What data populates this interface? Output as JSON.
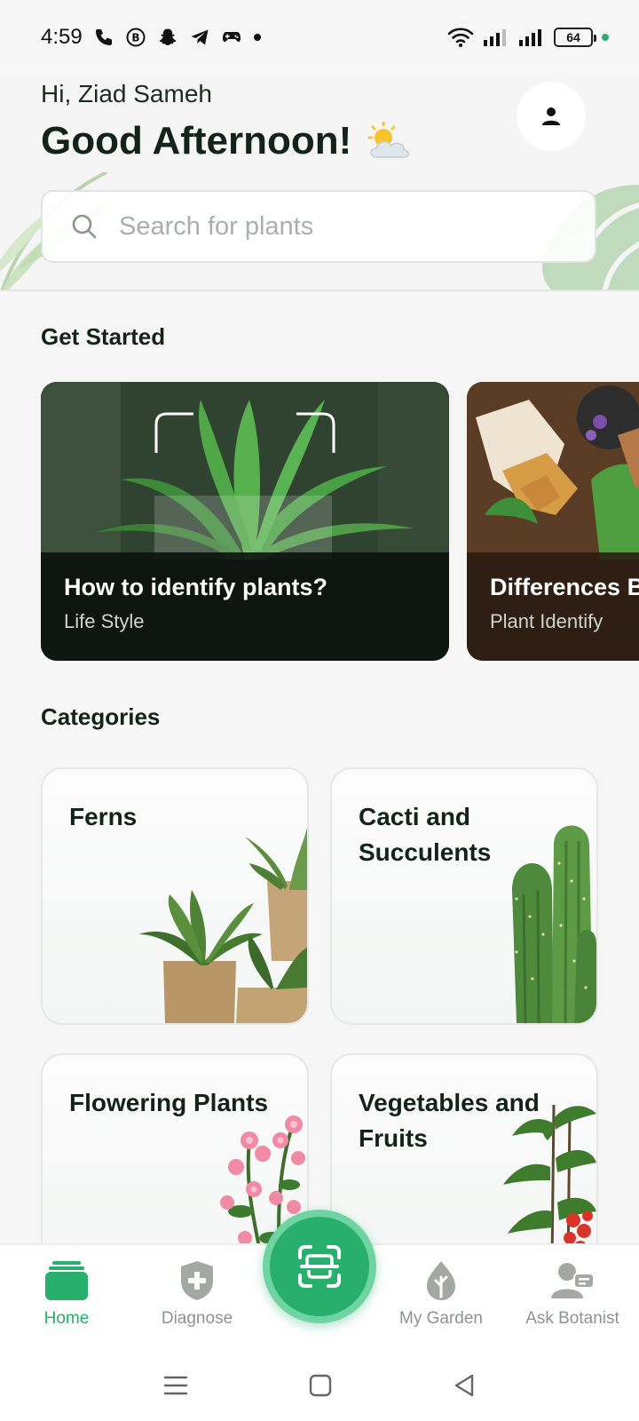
{
  "status_bar": {
    "time": "4:59",
    "battery": "64",
    "icons": [
      "phone-icon",
      "b-icon",
      "snapchat-icon",
      "telegram-icon",
      "game-icon",
      "dot-icon",
      "wifi-icon",
      "signal-icon",
      "signal-icon",
      "battery-icon"
    ]
  },
  "header": {
    "greeting": "Hi, Ziad Sameh",
    "title": "Good Afternoon!",
    "weather_icon": "sun-cloud-icon"
  },
  "search": {
    "placeholder": "Search for plants"
  },
  "get_started": {
    "title": "Get Started",
    "cards": [
      {
        "title": "How to identify plants?",
        "subtitle": "Life Style"
      },
      {
        "title": "Differences B",
        "subtitle": "Plant Identify"
      }
    ]
  },
  "categories": {
    "title": "Categories",
    "items": [
      {
        "line1": "Ferns",
        "line2": ""
      },
      {
        "line1": "Cacti and",
        "line2": "Succulents"
      },
      {
        "line1": "Flowering Plants",
        "line2": ""
      },
      {
        "line1": "Vegetables and",
        "line2": "Fruits"
      }
    ]
  },
  "nav": {
    "home": "Home",
    "diagnose": "Diagnose",
    "my_garden": "My Garden",
    "ask_botanist": "Ask Botanist"
  },
  "colors": {
    "accent": "#28af6e",
    "text_dark": "#13231b",
    "muted": "#8e9390"
  }
}
